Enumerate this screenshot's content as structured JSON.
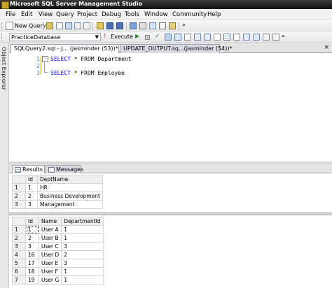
{
  "window": {
    "title": "Microsoft SQL Server Management Studio"
  },
  "menu": [
    "File",
    "Edit",
    "View",
    "Query",
    "Project",
    "Debug",
    "Tools",
    "Window",
    "Community",
    "Help"
  ],
  "toolbar": {
    "new_query_label": "New Query"
  },
  "query_toolbar": {
    "database": "PracticeDatabase",
    "execute_label": "Execute"
  },
  "object_explorer": {
    "label": "Object Explorer"
  },
  "doc_tabs": [
    "SQLQuery2.sql - J... (jasminder (53))*",
    "UPDATE_OUTPUT.sq...(jasminder (54))*"
  ],
  "editor": {
    "lines": [
      {
        "num": "1",
        "keyword": "SELECT",
        "rest": " * FROM Department"
      },
      {
        "num": "2",
        "keyword": "",
        "rest": ""
      },
      {
        "num": "3",
        "keyword": "SELECT",
        "rest": " * FROM Employee"
      }
    ]
  },
  "results_tabs": {
    "results": "Results",
    "messages": "Messages"
  },
  "grid1": {
    "columns": [
      "",
      "Id",
      "DeptName"
    ],
    "rows": [
      [
        "1",
        "1",
        "HR"
      ],
      [
        "2",
        "2",
        "Business Development"
      ],
      [
        "3",
        "3",
        "Management"
      ]
    ]
  },
  "grid2": {
    "columns": [
      "",
      "Id",
      "Name",
      "DepartmentId"
    ],
    "rows": [
      [
        "1",
        "1",
        "User A",
        "1"
      ],
      [
        "2",
        "2",
        "User B",
        "1"
      ],
      [
        "3",
        "3",
        "User C",
        "3"
      ],
      [
        "4",
        "16",
        "User D",
        "2"
      ],
      [
        "5",
        "17",
        "User E",
        "3"
      ],
      [
        "6",
        "18",
        "User F",
        "1"
      ],
      [
        "7",
        "19",
        "User G",
        "1"
      ]
    ]
  }
}
